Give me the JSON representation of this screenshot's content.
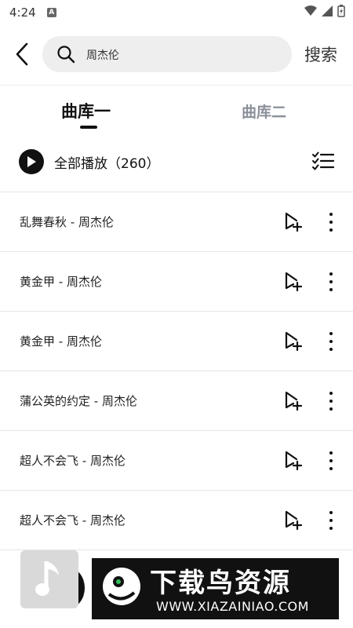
{
  "status_bar": {
    "time": "4:24",
    "notif_letter": "A"
  },
  "search": {
    "query": "周杰伦",
    "button_label": "搜索"
  },
  "tabs": [
    {
      "label": "曲库一",
      "active": true
    },
    {
      "label": "曲库二",
      "active": false
    }
  ],
  "play_all": {
    "label": "全部播放（260）"
  },
  "songs": [
    {
      "title": "乱舞春秋 - 周杰伦"
    },
    {
      "title": "黄金甲 - 周杰伦"
    },
    {
      "title": "黄金甲 - 周杰伦"
    },
    {
      "title": "蒲公英的约定 - 周杰伦"
    },
    {
      "title": "超人不会飞 - 周杰伦"
    },
    {
      "title": "超人不会飞 - 周杰伦"
    }
  ],
  "watermark": {
    "title": "下载鸟资源",
    "url": "WWW.XIAZAINIAO.COM"
  },
  "icons": {
    "back": "chevron-left-icon",
    "search": "search-icon",
    "play": "play-icon",
    "multi_select": "checklist-icon",
    "add_to_playlist": "add-to-playlist-icon",
    "more": "more-vertical-icon"
  },
  "colors": {
    "active_tab": "#111111",
    "inactive_tab": "#8a8f99",
    "search_bg": "#eeeeee"
  }
}
